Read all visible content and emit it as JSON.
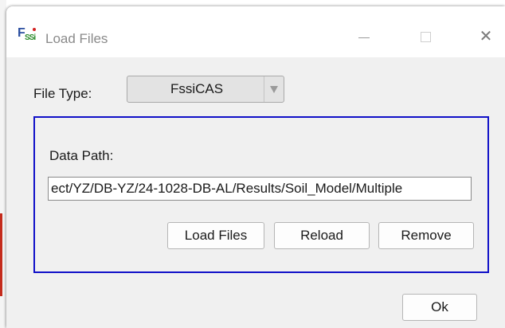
{
  "window": {
    "title": "Load Files",
    "icon": "fssi-app-icon",
    "controls": [
      "minimize-icon",
      "maximize-icon",
      "close-icon"
    ],
    "close_glyph": "✕"
  },
  "file_type": {
    "label": "File Type:",
    "selected": "FssiCAS"
  },
  "data_path": {
    "label": "Data Path:",
    "value": "ect/YZ/DB-YZ/24-1028-DB-AL/Results/Soil_Model/Multiple"
  },
  "buttons": {
    "load_files": "Load Files",
    "reload": "Reload",
    "remove": "Remove",
    "ok": "Ok"
  },
  "colors": {
    "group_border": "#1010c8",
    "background": "#f0f0f0"
  }
}
